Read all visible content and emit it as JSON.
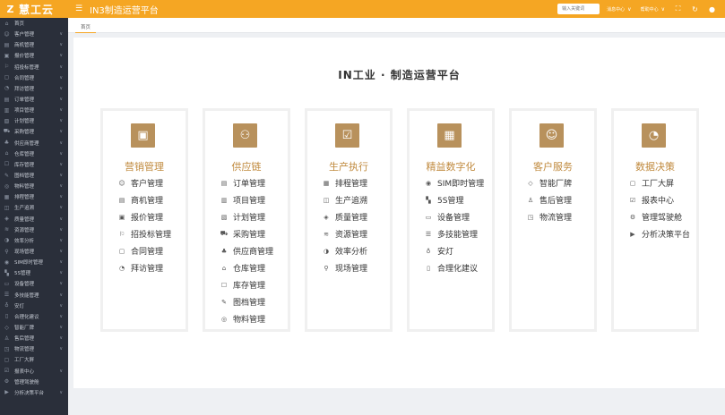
{
  "header": {
    "logo_text": "慧工云",
    "logo_mark": "Z",
    "menu_icon": "hamburger-icon",
    "app_title": "IN3制造运营平台",
    "search_placeholder": "输入关键词",
    "links": [
      {
        "label": "消息中心"
      },
      {
        "label": "帮助中心"
      }
    ],
    "icons": [
      "fullscreen-icon",
      "refresh-icon",
      "user-icon"
    ]
  },
  "sidebar": {
    "items": [
      {
        "label": "首页",
        "icon": "home-icon",
        "chev": ""
      },
      {
        "label": "客户管理",
        "icon": "customer-icon",
        "chev": "∨"
      },
      {
        "label": "商机管理",
        "icon": "opportunity-icon",
        "chev": "∨"
      },
      {
        "label": "报价管理",
        "icon": "quote-icon",
        "chev": "∨"
      },
      {
        "label": "招投标管理",
        "icon": "bid-icon",
        "chev": "∨"
      },
      {
        "label": "合同管理",
        "icon": "contract-icon",
        "chev": "∨"
      },
      {
        "label": "拜访管理",
        "icon": "visit-icon",
        "chev": "∨"
      },
      {
        "label": "订单管理",
        "icon": "order-icon",
        "chev": "∨"
      },
      {
        "label": "项目管理",
        "icon": "project-icon",
        "chev": "∨"
      },
      {
        "label": "计划管理",
        "icon": "plan-icon",
        "chev": "∨"
      },
      {
        "label": "采购管理",
        "icon": "purchase-icon",
        "chev": "∨"
      },
      {
        "label": "供应商管理",
        "icon": "supplier-icon",
        "chev": "∨"
      },
      {
        "label": "仓库管理",
        "icon": "warehouse-icon",
        "chev": "∨"
      },
      {
        "label": "库存管理",
        "icon": "inventory-icon",
        "chev": "∨"
      },
      {
        "label": "图档管理",
        "icon": "drawing-icon",
        "chev": "∨"
      },
      {
        "label": "物料管理",
        "icon": "material-icon",
        "chev": "∨"
      },
      {
        "label": "排程管理",
        "icon": "schedule-icon",
        "chev": "∨"
      },
      {
        "label": "生产追溯",
        "icon": "trace-icon",
        "chev": "∨"
      },
      {
        "label": "质量管理",
        "icon": "quality-icon",
        "chev": "∨"
      },
      {
        "label": "资源管理",
        "icon": "resource-icon",
        "chev": "∨"
      },
      {
        "label": "效率分析",
        "icon": "efficiency-icon",
        "chev": "∨"
      },
      {
        "label": "现场管理",
        "icon": "site-icon",
        "chev": "∨"
      },
      {
        "label": "SIM即时管理",
        "icon": "sim-icon",
        "chev": "∨"
      },
      {
        "label": "5S管理",
        "icon": "fives-icon",
        "chev": "∨"
      },
      {
        "label": "设备管理",
        "icon": "equipment-icon",
        "chev": "∨"
      },
      {
        "label": "多技能管理",
        "icon": "skill-icon",
        "chev": "∨"
      },
      {
        "label": "安灯",
        "icon": "andon-icon",
        "chev": "∨"
      },
      {
        "label": "合理化建议",
        "icon": "suggestion-icon",
        "chev": "∨"
      },
      {
        "label": "智能厂牌",
        "icon": "badge-icon",
        "chev": "∨"
      },
      {
        "label": "售后管理",
        "icon": "aftersales-icon",
        "chev": "∨"
      },
      {
        "label": "物流管理",
        "icon": "logistics-icon",
        "chev": "∨"
      },
      {
        "label": "工厂大屏",
        "icon": "screen-icon",
        "chev": ""
      },
      {
        "label": "报表中心",
        "icon": "report-icon",
        "chev": "∨"
      },
      {
        "label": "管理驾驶舱",
        "icon": "cockpit-icon",
        "chev": ""
      },
      {
        "label": "分析决策平台",
        "icon": "analysis-icon",
        "chev": "∨"
      }
    ]
  },
  "tabs": [
    {
      "label": "首页"
    }
  ],
  "main": {
    "title": "IN工业 · 制造运营平台",
    "cards": [
      {
        "title": "营销管理",
        "icon": "chart-up-icon",
        "items": [
          {
            "label": "客户管理",
            "icon": "customer-icon"
          },
          {
            "label": "商机管理",
            "icon": "opportunity-icon"
          },
          {
            "label": "报价管理",
            "icon": "quote-icon"
          },
          {
            "label": "招投标管理",
            "icon": "bid-icon"
          },
          {
            "label": "合同管理",
            "icon": "contract-icon"
          },
          {
            "label": "拜访管理",
            "icon": "visit-icon"
          }
        ]
      },
      {
        "title": "供应链",
        "icon": "network-icon",
        "items": [
          {
            "label": "订单管理",
            "icon": "order-icon"
          },
          {
            "label": "项目管理",
            "icon": "project-icon"
          },
          {
            "label": "计划管理",
            "icon": "plan-icon"
          },
          {
            "label": "采购管理",
            "icon": "purchase-icon"
          },
          {
            "label": "供应商管理",
            "icon": "supplier-icon"
          },
          {
            "label": "仓库管理",
            "icon": "warehouse-icon"
          },
          {
            "label": "库存管理",
            "icon": "inventory-icon"
          },
          {
            "label": "图档管理",
            "icon": "drawing-icon"
          },
          {
            "label": "物料管理",
            "icon": "material-icon"
          }
        ]
      },
      {
        "title": "生产执行",
        "icon": "clipboard-check-icon",
        "items": [
          {
            "label": "排程管理",
            "icon": "schedule-icon"
          },
          {
            "label": "生产追溯",
            "icon": "trace-icon"
          },
          {
            "label": "质量管理",
            "icon": "quality-icon"
          },
          {
            "label": "资源管理",
            "icon": "resource-icon"
          },
          {
            "label": "效率分析",
            "icon": "efficiency-icon"
          },
          {
            "label": "现场管理",
            "icon": "site-icon"
          }
        ]
      },
      {
        "title": "精益数字化",
        "icon": "grid-icon",
        "items": [
          {
            "label": "SIM即时管理",
            "icon": "sim-icon"
          },
          {
            "label": "5S管理",
            "icon": "fives-icon"
          },
          {
            "label": "设备管理",
            "icon": "equipment-icon"
          },
          {
            "label": "多技能管理",
            "icon": "skill-icon"
          },
          {
            "label": "安灯",
            "icon": "andon-icon"
          },
          {
            "label": "合理化建议",
            "icon": "suggestion-icon"
          }
        ]
      },
      {
        "title": "客户服务",
        "icon": "people-icon",
        "items": [
          {
            "label": "智能厂牌",
            "icon": "badge-icon"
          },
          {
            "label": "售后管理",
            "icon": "aftersales-icon"
          },
          {
            "label": "物流管理",
            "icon": "logistics-icon"
          }
        ]
      },
      {
        "title": "数据决策",
        "icon": "gauge-icon",
        "items": [
          {
            "label": "工厂大屏",
            "icon": "screen-icon"
          },
          {
            "label": "报表中心",
            "icon": "report-icon"
          },
          {
            "label": "管理驾驶舱",
            "icon": "cockpit-icon"
          },
          {
            "label": "分析决策平台",
            "icon": "analysis-icon"
          }
        ]
      }
    ]
  },
  "colors": {
    "header_bg": "#f5a623",
    "sidebar_bg": "#2a2f3a",
    "card_icon_bg": "#b8915c",
    "card_title": "#c08a3e"
  }
}
